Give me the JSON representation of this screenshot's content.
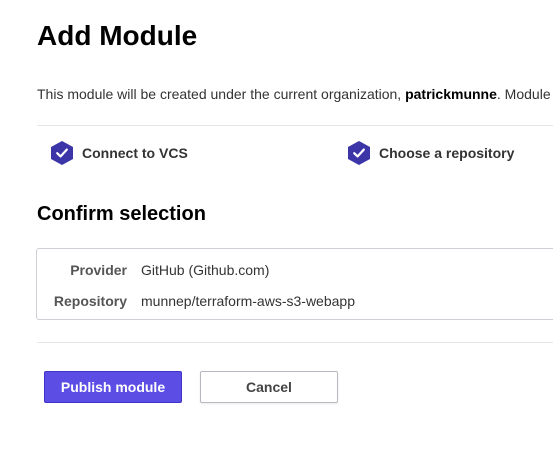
{
  "page": {
    "title": "Add Module",
    "intro_prefix": "This module will be created under the current organization, ",
    "organization": "patrickmunne",
    "intro_suffix": ". Module"
  },
  "steps": [
    {
      "label": "Connect to VCS",
      "status": "complete",
      "icon": "check-hexagon-icon"
    },
    {
      "label": "Choose a repository",
      "status": "complete",
      "icon": "check-hexagon-icon"
    }
  ],
  "confirm": {
    "heading": "Confirm selection",
    "provider_label": "Provider",
    "provider_value": "GitHub (Github.com)",
    "repository_label": "Repository",
    "repository_value": "munnep/terraform-aws-s3-webapp"
  },
  "actions": {
    "publish_label": "Publish module",
    "cancel_label": "Cancel"
  },
  "colors": {
    "accent": "#5c4ee5",
    "step_icon": "#3b35a8"
  }
}
